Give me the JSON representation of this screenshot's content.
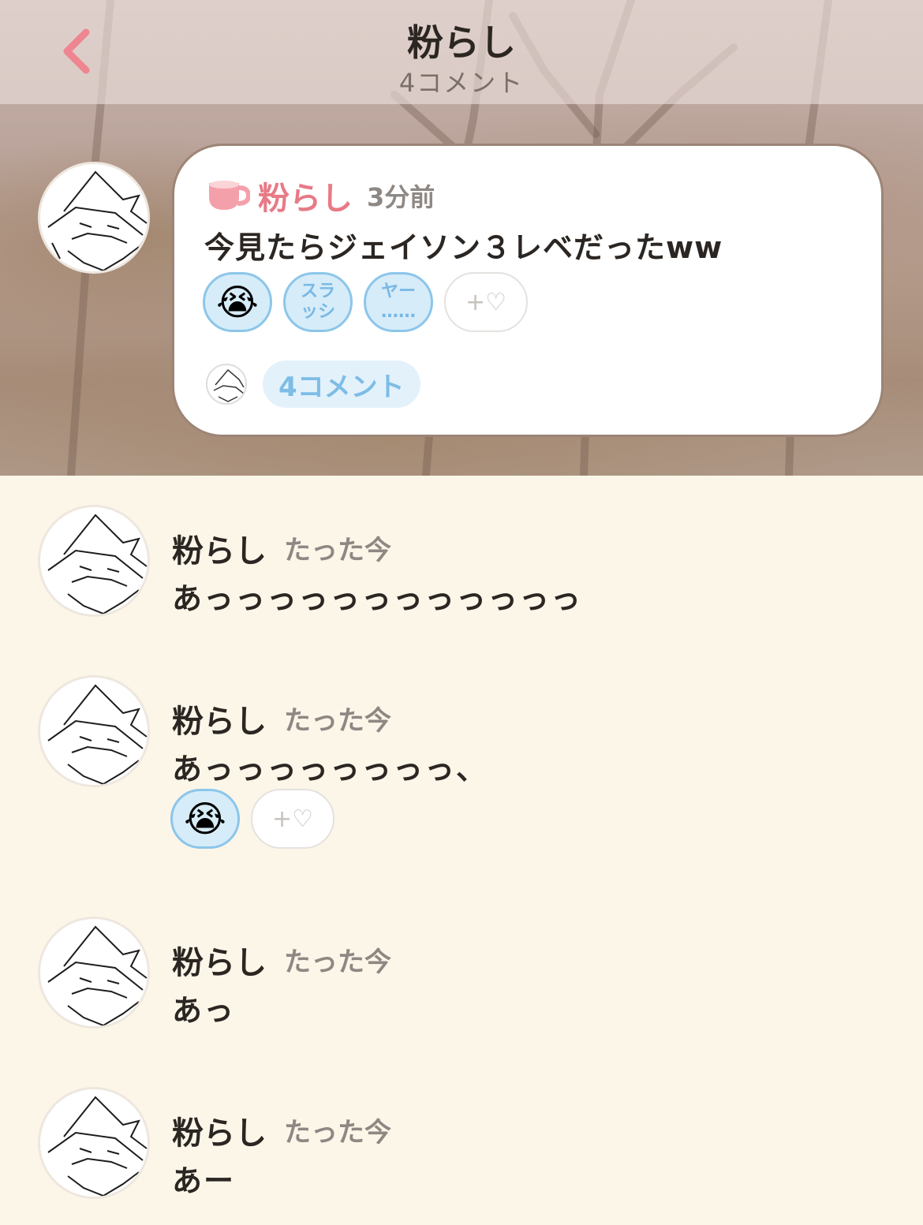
{
  "header": {
    "title": "粉らし",
    "subtitle": "4コメント"
  },
  "post": {
    "author": "粉らし",
    "time": "3分前",
    "text": "今見たらジェイソン３レベだったww",
    "reactions": [
      {
        "type": "emoji",
        "value": "😭"
      },
      {
        "type": "stamp",
        "line1": "スラ",
        "line2": "ッシ"
      },
      {
        "type": "stamp",
        "line1": "ヤー",
        "line2": "……"
      }
    ],
    "add_reaction_label": "+♡",
    "comment_count_label": "4コメント"
  },
  "comments": [
    {
      "author": "粉らし",
      "time": "たった今",
      "text": "あっっっっっっっっっっっっ"
    },
    {
      "author": "粉らし",
      "time": "たった今",
      "text": "あっっっっっっっっ、",
      "reactions": [
        "😭"
      ]
    },
    {
      "author": "粉らし",
      "time": "たった今",
      "text": "あっ"
    },
    {
      "author": "粉らし",
      "time": "たった今",
      "text": "あー"
    }
  ],
  "icons": {
    "back": "chevron-left-icon",
    "cup": "teacup-icon",
    "heart": "heart-outline-icon"
  },
  "colors": {
    "accent_pink": "#e77a86",
    "reaction_blue": "#8cc6ea",
    "background": "#fcf6e9"
  }
}
